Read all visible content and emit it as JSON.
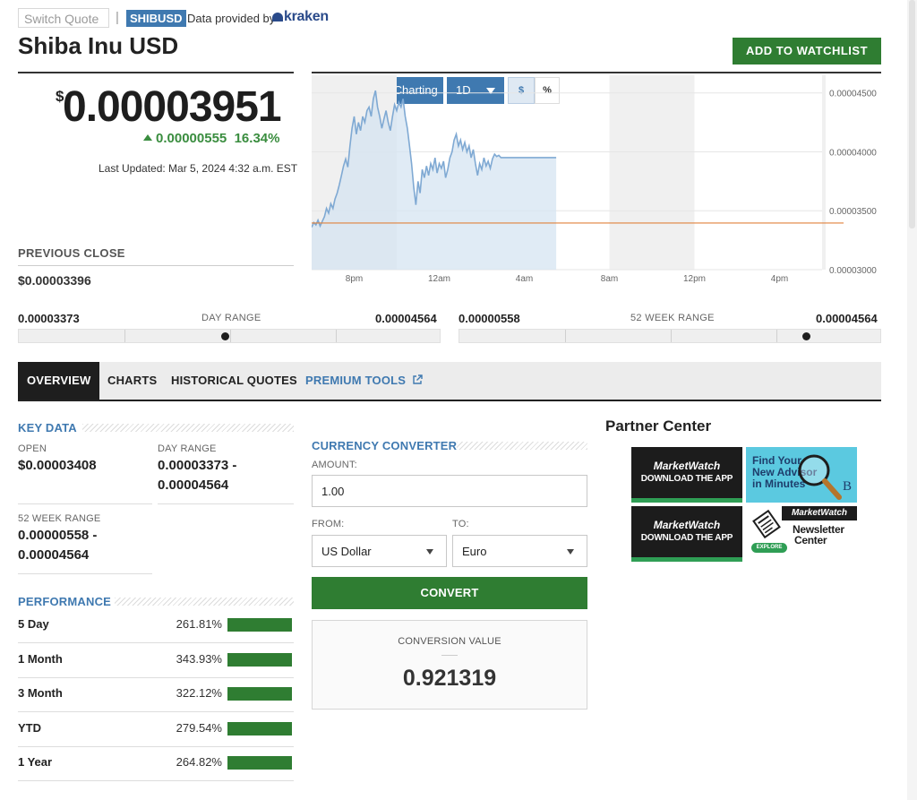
{
  "header": {
    "search_placeholder": "Switch Quote",
    "ticker": "SHIBUSD",
    "provided_by": "Data provided by",
    "provider": "kraken",
    "title": "Shiba Inu USD",
    "watchlist_label": "ADD TO WATCHLIST"
  },
  "quote": {
    "currency_symbol": "$",
    "price": "0.00003951",
    "change": "0.00000555",
    "change_pct": "16.34%",
    "last_updated": "Last Updated: Mar 5, 2024 4:32 a.m. EST",
    "previous_close_label": "PREVIOUS CLOSE",
    "previous_close": "$0.00003396"
  },
  "chart_toolbar": {
    "back": "‹",
    "advanced": "Advanced Charting",
    "interval": "1D",
    "mode_dollar": "$",
    "mode_pct": "%"
  },
  "chart_data": {
    "type": "area",
    "title": "",
    "xlabel": "",
    "ylabel": "",
    "x_tick_labels": [
      "8pm",
      "12am",
      "4am",
      "8am",
      "12pm",
      "4pm"
    ],
    "y_tick_labels": [
      "0.00004500",
      "0.00004000",
      "0.00003500",
      "0.00003000"
    ],
    "ylim": [
      3e-05,
      4.65e-05
    ],
    "previous_close_line": 3.396e-05,
    "series": [
      {
        "color": "#7fa9d3",
        "hours_since_6pm": [
          0,
          0.5,
          1,
          1.5,
          2,
          2.5,
          3,
          3.5,
          4,
          4.5,
          5,
          5.5,
          6,
          6.5,
          7,
          7.5,
          8,
          8.5,
          9,
          9.5,
          10,
          10.5,
          11,
          11.5,
          12,
          12.5,
          13,
          13.5,
          14,
          14.5,
          15,
          15.5,
          16,
          16.5,
          17,
          17.5,
          18,
          18.5,
          19,
          19.5,
          20,
          20.5,
          21,
          21.5,
          22,
          22.5,
          23,
          23.5,
          24,
          24.5,
          25,
          25.5,
          26,
          26.5,
          27,
          27.5,
          28,
          28.5,
          29,
          29.5,
          30,
          30.5,
          31,
          31.5,
          32,
          32.5,
          33,
          33.5,
          34,
          34.5,
          35,
          35.5,
          36,
          36.5,
          37,
          37.5,
          38,
          38.5,
          39,
          39.5,
          40,
          40.5,
          41,
          41.5,
          42,
          42.5,
          43,
          43.5,
          44,
          44.5,
          45,
          45.5,
          46,
          46.5,
          47,
          47.5,
          48,
          48.5,
          49,
          49.5,
          50,
          50.5,
          51,
          51.5,
          52,
          52.5,
          53,
          53.5,
          54,
          54.5,
          55,
          55.5,
          56,
          56.5,
          57,
          57.5
        ],
        "values": [
          3.36e-05,
          3.4e-05,
          3.38e-05,
          3.42e-05,
          3.37e-05,
          3.41e-05,
          3.45e-05,
          3.52e-05,
          3.48e-05,
          3.56e-05,
          3.52e-05,
          3.6e-05,
          3.65e-05,
          3.72e-05,
          3.8e-05,
          3.88e-05,
          3.94e-05,
          3.87e-05,
          4.05e-05,
          4.2e-05,
          4.3e-05,
          4.15e-05,
          4.25e-05,
          4.18e-05,
          4.3e-05,
          4.25e-05,
          4.35e-05,
          4.38e-05,
          4.3e-05,
          4.45e-05,
          4.52e-05,
          4.38e-05,
          4.3e-05,
          4.2e-05,
          4.28e-05,
          4.35e-05,
          4.25e-05,
          4.18e-05,
          4.3e-05,
          4.4e-05,
          4.35e-05,
          4.42e-05,
          4.38e-05,
          4.45e-05,
          4.3e-05,
          4.2e-05,
          4.05e-05,
          3.9e-05,
          3.7e-05,
          3.55e-05,
          3.75e-05,
          3.65e-05,
          3.85e-05,
          3.78e-05,
          3.88e-05,
          3.8e-05,
          3.9e-05,
          3.85e-05,
          3.95e-05,
          3.82e-05,
          3.9e-05,
          3.86e-05,
          3.92e-05,
          3.78e-05,
          3.85e-05,
          3.95e-05,
          4e-05,
          4.1e-05,
          4.15e-05,
          4.05e-05,
          4.1e-05,
          4.02e-05,
          4.08e-05,
          4e-05,
          4.05e-05,
          3.95e-05,
          4.02e-05,
          3.9e-05,
          3.8e-05,
          3.9e-05,
          3.85e-05,
          3.95e-05,
          3.88e-05,
          3.92e-05,
          3.86e-05,
          3.94e-05,
          3.98e-05,
          3.96e-05,
          3.97e-05,
          3.951e-05,
          3.951e-05,
          3.951e-05,
          3.951e-05,
          3.951e-05,
          3.951e-05,
          3.951e-05,
          3.951e-05,
          3.951e-05,
          3.951e-05,
          3.951e-05,
          3.951e-05,
          3.951e-05,
          3.951e-05,
          3.951e-05,
          3.951e-05,
          3.951e-05,
          3.951e-05,
          3.951e-05,
          3.951e-05,
          3.951e-05,
          3.951e-05,
          3.951e-05,
          3.951e-05,
          3.951e-05,
          3.951e-05,
          3.951e-05
        ]
      }
    ],
    "grid": true,
    "legend": "none"
  },
  "ranges": {
    "day": {
      "low": "0.00003373",
      "label": "DAY RANGE",
      "high": "0.00004564",
      "position": 0.49
    },
    "week52": {
      "low": "0.00000558",
      "label": "52 WEEK RANGE",
      "high": "0.00004564",
      "position": 0.83
    }
  },
  "tabs": [
    "OVERVIEW",
    "CHARTS",
    "HISTORICAL QUOTES",
    "PREMIUM TOOLS"
  ],
  "key_data": {
    "heading": "KEY DATA",
    "open_label": "OPEN",
    "open": "$0.00003408",
    "day_range_label": "DAY RANGE",
    "day_range_line1": "0.00003373 -",
    "day_range_line2": "0.00004564",
    "week_range_label": "52 WEEK RANGE",
    "week_range_line1": "0.00000558 -",
    "week_range_line2": "0.00004564"
  },
  "performance": {
    "heading": "PERFORMANCE",
    "rows": [
      {
        "name": "5 Day",
        "pct": "261.81%"
      },
      {
        "name": "1 Month",
        "pct": "343.93%"
      },
      {
        "name": "3 Month",
        "pct": "322.12%"
      },
      {
        "name": "YTD",
        "pct": "279.54%"
      },
      {
        "name": "1 Year",
        "pct": "264.82%"
      }
    ]
  },
  "converter": {
    "heading": "CURRENCY CONVERTER",
    "amount_label": "AMOUNT:",
    "amount": "1.00",
    "from_label": "FROM:",
    "to_label": "TO:",
    "from": "US Dollar",
    "to": "Euro",
    "convert_label": "CONVERT",
    "result_label": "CONVERSION VALUE",
    "result": "0.921319"
  },
  "partner": {
    "title": "Partner Center",
    "mw_brand": "MarketWatch",
    "mw_download": "DOWNLOAD THE APP",
    "advisor_line1": "Find Your",
    "advisor_line2": "New Advisor",
    "advisor_line3": "in Minutes",
    "advisor_logo": "B",
    "newsletter_brand": "MarketWatch",
    "newsletter_line1": "Newsletter",
    "newsletter_line2": "Center",
    "newsletter_explore": "EXPLORE"
  },
  "colors": {
    "accent_blue": "#3f79b0",
    "accent_green": "#2f7d32",
    "price_up": "#3a8d3f",
    "prev_close_line": "#e0823c"
  }
}
